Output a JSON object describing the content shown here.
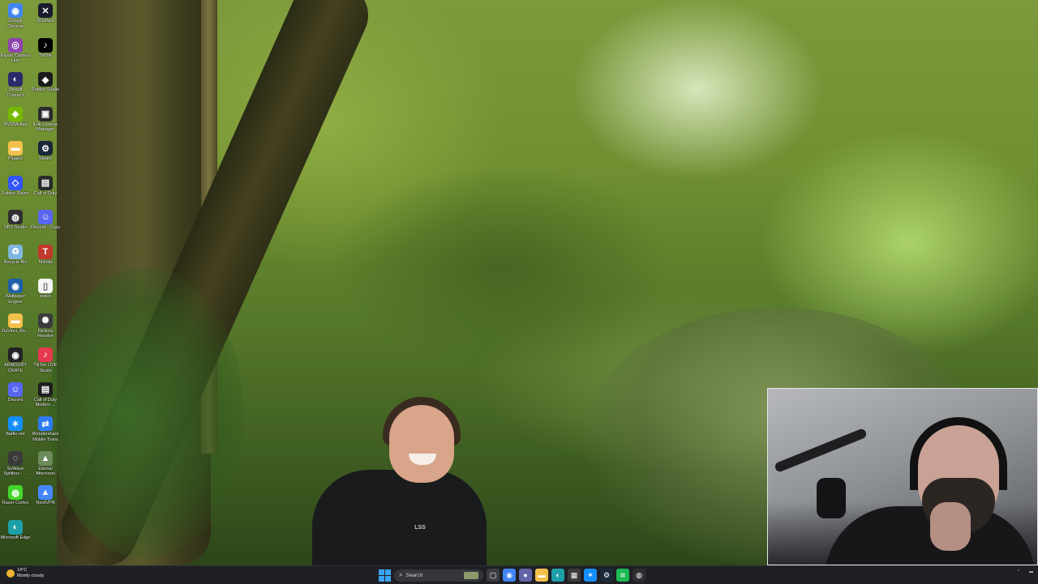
{
  "desktop_icons": [
    {
      "label": "Google Chrome",
      "icon": "chrome-icon",
      "color": "#4285f4",
      "glyph": "◉"
    },
    {
      "label": "XDefiant",
      "icon": "xdefiant-icon",
      "color": "#1a1a2e",
      "glyph": "✕"
    },
    {
      "label": "Elgato Camera Hub",
      "icon": "camera-hub-icon",
      "color": "#8e44ad",
      "glyph": "◎"
    },
    {
      "label": "TikTok",
      "icon": "tiktok-icon",
      "color": "#000000",
      "glyph": "♪"
    },
    {
      "label": "Ubisoft Connect",
      "icon": "ubisoft-icon",
      "color": "#2b2b6b",
      "glyph": "◐"
    },
    {
      "label": "Roblox Studio",
      "icon": "roblox-studio-icon",
      "color": "#1b1b1b",
      "glyph": "◆"
    },
    {
      "label": "NVIDIA App",
      "icon": "nvidia-icon",
      "color": "#76b900",
      "glyph": "◈"
    },
    {
      "label": "iLok License Manager",
      "icon": "ilok-icon",
      "color": "#2a2a2a",
      "glyph": "▣"
    },
    {
      "label": "Plugins",
      "icon": "folder-icon",
      "color": "#f3c14b",
      "glyph": "▬"
    },
    {
      "label": "Steam",
      "icon": "steam-icon",
      "color": "#1b2838",
      "glyph": "⚙"
    },
    {
      "label": "Roblox Player",
      "icon": "roblox-player-icon",
      "color": "#3355ff",
      "glyph": "◇"
    },
    {
      "label": "Call of Duty",
      "icon": "call-of-duty-icon",
      "color": "#2a2a2a",
      "glyph": "▤"
    },
    {
      "label": "OBS Studio",
      "icon": "obs-icon",
      "color": "#302e31",
      "glyph": "◍"
    },
    {
      "label": "Discord - Copy",
      "icon": "discord-icon",
      "color": "#5865f2",
      "glyph": "☺"
    },
    {
      "label": "Recycle Bin",
      "icon": "recycle-bin-icon",
      "color": "#7fb6e0",
      "glyph": "♻"
    },
    {
      "label": "Tikfinity",
      "icon": "tikfinity-icon",
      "color": "#c0392b",
      "glyph": "T"
    },
    {
      "label": "Wallpaper Engine",
      "icon": "wallpaper-engine-icon",
      "color": "#1d5fa8",
      "glyph": "◉"
    },
    {
      "label": "watch",
      "icon": "file-icon",
      "color": "#f4f4f4",
      "glyph": "▯"
    },
    {
      "label": "DaVinci_Re...",
      "icon": "folder-icon",
      "color": "#f3c14b",
      "glyph": "▬"
    },
    {
      "label": "DaVinci Resolve",
      "icon": "davinci-icon",
      "color": "#3b3b3b",
      "glyph": "✺"
    },
    {
      "label": "ARMOURY CRATE",
      "icon": "armoury-crate-icon",
      "color": "#222222",
      "glyph": "◉"
    },
    {
      "label": "TikTok LIVE Studio",
      "icon": "tiktok-live-icon",
      "color": "#e63950",
      "glyph": "♪"
    },
    {
      "label": "Discord",
      "icon": "discord-icon",
      "color": "#5865f2",
      "glyph": "☺"
    },
    {
      "label": "Call of Duty Modern ...",
      "icon": "call-of-duty-icon",
      "color": "#1e1e1e",
      "glyph": "▤"
    },
    {
      "label": "Battle.net",
      "icon": "battlenet-icon",
      "color": "#148eff",
      "glyph": "✶"
    },
    {
      "label": "Wondershare Mobile Trans",
      "icon": "wondershare-icon",
      "color": "#2d7bf4",
      "glyph": "⇄"
    },
    {
      "label": "SoWave Splitbox - ...",
      "icon": "splitbox-icon",
      "color": "#3a3a3a",
      "glyph": "◌"
    },
    {
      "label": "Eternal Afternoon",
      "icon": "eternal-afternoon-icon",
      "color": "#6d8b5a",
      "glyph": "▲"
    },
    {
      "label": "Razer Cortex",
      "icon": "razer-icon",
      "color": "#44d62c",
      "glyph": "◍"
    },
    {
      "label": "NordVPN",
      "icon": "nordvpn-icon",
      "color": "#4687ff",
      "glyph": "▲"
    },
    {
      "label": "Microsoft Edge",
      "icon": "edge-icon",
      "color": "#1ea0a8",
      "glyph": "◐"
    }
  ],
  "wallpaper": {
    "shirt_text": "LSS"
  },
  "taskbar": {
    "weather_temp": "14°C",
    "weather_desc": "Mostly cloudy",
    "search_label": "Search",
    "apps": [
      {
        "icon": "task-view-icon",
        "color": "#3c3d42",
        "glyph": "▢"
      },
      {
        "icon": "chrome-icon",
        "color": "#4285f4",
        "glyph": "◉"
      },
      {
        "icon": "teams-icon",
        "color": "#6264a7",
        "glyph": "●"
      },
      {
        "icon": "file-explorer-icon",
        "color": "#f3c14b",
        "glyph": "▬"
      },
      {
        "icon": "edge-icon",
        "color": "#1ea0a8",
        "glyph": "◐"
      },
      {
        "icon": "store-icon",
        "color": "#3b3b3b",
        "glyph": "▦"
      },
      {
        "icon": "battlenet-icon",
        "color": "#148eff",
        "glyph": "✶"
      },
      {
        "icon": "steam-icon",
        "color": "#1b2838",
        "glyph": "⚙"
      },
      {
        "icon": "spotify-icon",
        "color": "#1db954",
        "glyph": "≋"
      },
      {
        "icon": "obs-icon",
        "color": "#302e31",
        "glyph": "◍"
      }
    ]
  }
}
